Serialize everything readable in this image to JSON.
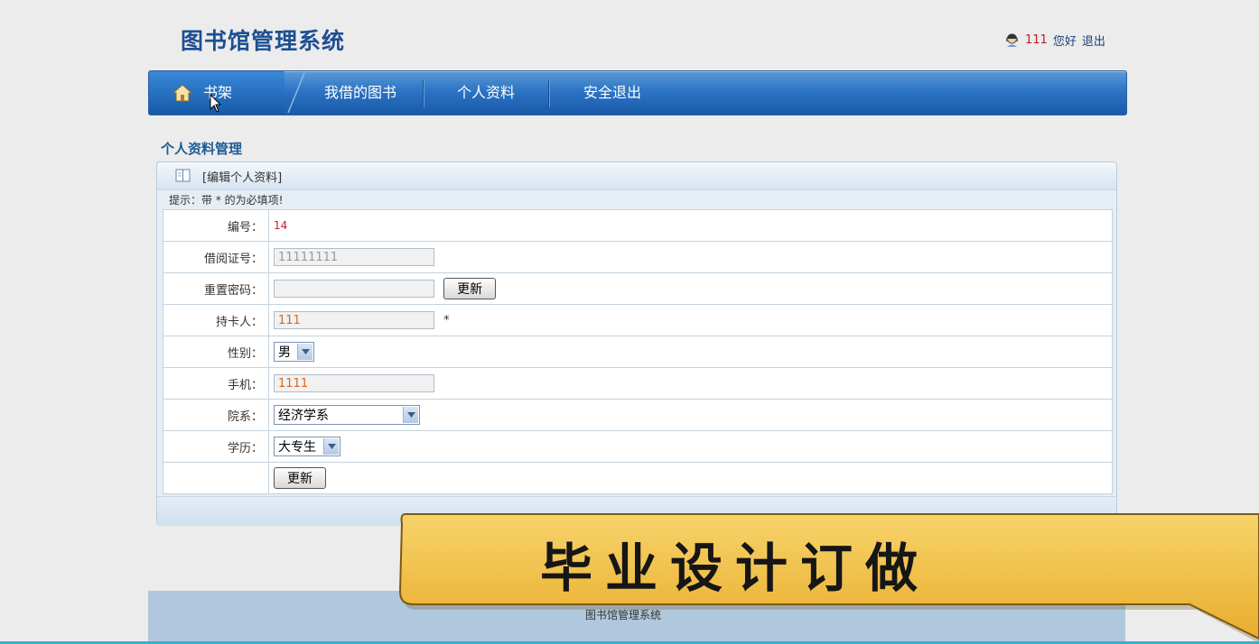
{
  "header": {
    "app_title": "图书馆管理系统",
    "user_id": "111",
    "greeting": "您好",
    "logout": "退出"
  },
  "nav": {
    "items": [
      {
        "label": "书架",
        "icon": "home-icon",
        "active": true
      },
      {
        "label": "我借的图书"
      },
      {
        "label": "个人资料"
      },
      {
        "label": "安全退出"
      }
    ]
  },
  "section_title": "个人资料管理",
  "panel": {
    "title": "[编辑个人资料]",
    "hint": "提示：带 * 的为必填项!"
  },
  "form": {
    "id_label": "编号：",
    "id_value": "14",
    "card_label": "借阅证号：",
    "card_value": "11111111",
    "password_label": "重置密码：",
    "password_value": "",
    "password_button": "更新",
    "holder_label": "持卡人：",
    "holder_value": "111",
    "required_mark": "*",
    "gender_label": "性别：",
    "gender_value": "男",
    "phone_label": "手机：",
    "phone_value": "1111",
    "dept_label": "院系：",
    "dept_value": "经济学系",
    "edu_label": "学历：",
    "edu_value": "大专生",
    "submit_button": "更新"
  },
  "footer": {
    "text": "图书馆管理系统"
  },
  "overlay": {
    "banner_text": "毕业设计订做"
  },
  "colors": {
    "nav_blue": "#2c74c4",
    "title_blue": "#1d4f92",
    "id_red": "#c0202a",
    "input_orange": "#d2691e",
    "banner_yellow": "#f3c14a"
  }
}
